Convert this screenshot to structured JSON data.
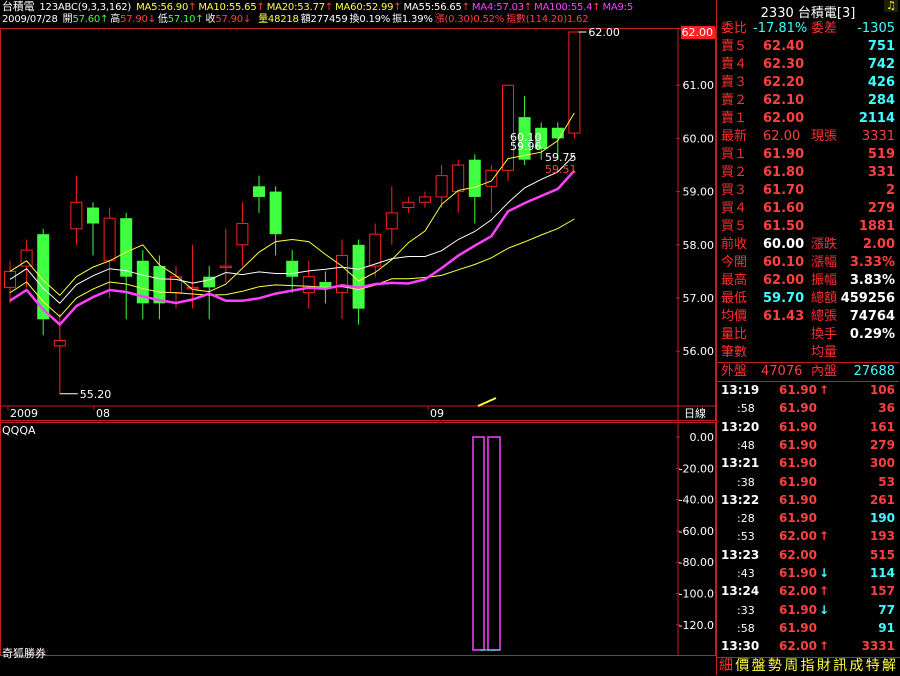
{
  "header": {
    "stock_name": "台積電",
    "indicator": "123ABC(9,3,3,162)",
    "ma_values": [
      {
        "label": "MA5:56.90",
        "color": "#ffff40",
        "arrow": "↑",
        "arrow_color": "#ff4040"
      },
      {
        "label": "MA10:55.65",
        "color": "#ffff40",
        "arrow": "↑",
        "arrow_color": "#ff4040"
      },
      {
        "label": "MA20:53.77",
        "color": "#ffff40",
        "arrow": "↑",
        "arrow_color": "#ff4040"
      },
      {
        "label": "MA60:52.99",
        "color": "#ffff40",
        "arrow": "↑",
        "arrow_color": "#ff4040"
      },
      {
        "label": "MA55:56.65",
        "color": "#ffffff",
        "arrow": "↑",
        "arrow_color": "#ff4040"
      },
      {
        "label": "MA4:57.03",
        "color": "#ff40ff",
        "arrow": "↑",
        "arrow_color": "#ff4040"
      },
      {
        "label": "MA100:55.4",
        "color": "#ff40ff",
        "arrow": "↑",
        "arrow_color": "#ff4040"
      },
      {
        "label": "MA9:5",
        "color": "#ff40ff",
        "arrow": "",
        "arrow_color": "#ff4040"
      }
    ],
    "date": "2009/07/28",
    "ohlc": [
      {
        "label": "開",
        "value": "57.60",
        "arrow": "↑",
        "color": "#40ff40"
      },
      {
        "label": "高",
        "value": "57.90",
        "arrow": "↓",
        "color": "#ff4040"
      },
      {
        "label": "低",
        "value": "57.10",
        "arrow": "↑",
        "color": "#40ff40"
      },
      {
        "label": "收",
        "value": "57.90",
        "arrow": "↓",
        "color": "#ff4040"
      }
    ],
    "stats": [
      {
        "text": "量48218",
        "color": "#ffff40"
      },
      {
        "text": "額277459",
        "color": "#ffffff"
      },
      {
        "text": "換0.19%",
        "color": "#ffffff"
      },
      {
        "text": "振1.39%",
        "color": "#ffffff"
      },
      {
        "text": "漲(0.30)0.52%",
        "color": "#ff4040"
      },
      {
        "text": "指數(114.20)1.62",
        "color": "#ff4040"
      }
    ],
    "bell_icon": "bell-icon"
  },
  "main_chart": {
    "price_axis": [
      "62.00",
      "61.00",
      "60.00",
      "59.00",
      "58.00",
      "57.00",
      "56.00"
    ],
    "top_badge": "62.00",
    "high_label": "62.00",
    "low_label": "55.20",
    "callouts": [
      {
        "text": "60.10",
        "color": "#ffffff"
      },
      {
        "text": "59.96",
        "color": "#ffffff"
      },
      {
        "text": "59.75",
        "color": "#ffffff"
      },
      {
        "text": "59.51",
        "color": "#ff4040"
      }
    ],
    "x_labels": [
      "2009",
      "08",
      "09"
    ],
    "period_label": "日線"
  },
  "sub_chart": {
    "title": "QQQA",
    "axis": [
      "0.00",
      "-20.00",
      "-40.00",
      "-60.00",
      "-80.00",
      "-100.0",
      "-120.0"
    ]
  },
  "footer_brand": "奇狐勝券",
  "chart_data": {
    "type": "candlestick",
    "ylim": [
      55.2,
      62.0
    ],
    "x_labels": [
      "2009",
      "08",
      "09"
    ],
    "candles": [
      {
        "o": 57.2,
        "c": 57.5,
        "h": 57.7,
        "l": 56.9,
        "up": true
      },
      {
        "o": 57.6,
        "c": 57.9,
        "h": 58.1,
        "l": 57.2,
        "up": true
      },
      {
        "o": 58.2,
        "c": 56.6,
        "h": 58.3,
        "l": 56.3,
        "up": false
      },
      {
        "o": 56.1,
        "c": 56.2,
        "h": 56.7,
        "l": 55.2,
        "up": true
      },
      {
        "o": 58.3,
        "c": 58.8,
        "h": 59.3,
        "l": 58.0,
        "up": true
      },
      {
        "o": 58.7,
        "c": 58.4,
        "h": 58.8,
        "l": 57.8,
        "up": false
      },
      {
        "o": 57.7,
        "c": 58.5,
        "h": 58.7,
        "l": 57.0,
        "up": true
      },
      {
        "o": 58.5,
        "c": 57.4,
        "h": 58.6,
        "l": 56.6,
        "up": false
      },
      {
        "o": 57.7,
        "c": 56.9,
        "h": 57.9,
        "l": 56.6,
        "up": false
      },
      {
        "o": 57.6,
        "c": 56.9,
        "h": 57.8,
        "l": 56.6,
        "up": false
      },
      {
        "o": 57.1,
        "c": 57.4,
        "h": 57.6,
        "l": 56.8,
        "up": true
      },
      {
        "o": 57.2,
        "c": 57.2,
        "h": 58.0,
        "l": 56.8,
        "up": true
      },
      {
        "o": 57.4,
        "c": 57.2,
        "h": 57.6,
        "l": 56.6,
        "up": false
      },
      {
        "o": 57.6,
        "c": 57.6,
        "h": 58.3,
        "l": 57.3,
        "up": true
      },
      {
        "o": 58.0,
        "c": 58.4,
        "h": 58.8,
        "l": 57.6,
        "up": true
      },
      {
        "o": 59.1,
        "c": 58.9,
        "h": 59.3,
        "l": 58.6,
        "up": false
      },
      {
        "o": 59.0,
        "c": 58.2,
        "h": 59.1,
        "l": 57.8,
        "up": false
      },
      {
        "o": 57.7,
        "c": 57.4,
        "h": 57.9,
        "l": 57.1,
        "up": false
      },
      {
        "o": 57.1,
        "c": 57.4,
        "h": 57.7,
        "l": 56.8,
        "up": true
      },
      {
        "o": 57.3,
        "c": 57.2,
        "h": 57.5,
        "l": 56.9,
        "up": false
      },
      {
        "o": 57.1,
        "c": 57.8,
        "h": 58.1,
        "l": 56.6,
        "up": true
      },
      {
        "o": 58.0,
        "c": 56.8,
        "h": 58.1,
        "l": 56.5,
        "up": false
      },
      {
        "o": 57.6,
        "c": 58.2,
        "h": 58.4,
        "l": 57.4,
        "up": true
      },
      {
        "o": 58.3,
        "c": 58.6,
        "h": 59.1,
        "l": 58.0,
        "up": true
      },
      {
        "o": 58.7,
        "c": 58.8,
        "h": 58.9,
        "l": 58.6,
        "up": true
      },
      {
        "o": 58.8,
        "c": 58.9,
        "h": 59.0,
        "l": 58.7,
        "up": true
      },
      {
        "o": 58.9,
        "c": 59.3,
        "h": 59.5,
        "l": 58.7,
        "up": true
      },
      {
        "o": 59.0,
        "c": 59.5,
        "h": 59.6,
        "l": 58.6,
        "up": true
      },
      {
        "o": 59.6,
        "c": 58.9,
        "h": 59.7,
        "l": 58.4,
        "up": false
      },
      {
        "o": 59.1,
        "c": 59.4,
        "h": 59.5,
        "l": 58.6,
        "up": true
      },
      {
        "o": 59.4,
        "c": 61.0,
        "h": 61.0,
        "l": 59.2,
        "up": true
      },
      {
        "o": 60.4,
        "c": 59.6,
        "h": 60.8,
        "l": 59.5,
        "up": false
      },
      {
        "o": 60.2,
        "c": 59.8,
        "h": 60.3,
        "l": 59.6,
        "up": false
      },
      {
        "o": 60.2,
        "c": 60.0,
        "h": 60.3,
        "l": 59.6,
        "up": false
      },
      {
        "o": 60.1,
        "c": 62.0,
        "h": 62.0,
        "l": 60.0,
        "up": true
      }
    ],
    "series": [
      {
        "name": "MA(yellow)",
        "color": "#ffff40"
      },
      {
        "name": "MA(white)",
        "color": "#ffffff"
      },
      {
        "name": "MA(magenta)",
        "color": "#ff40ff"
      }
    ]
  },
  "right_panel": {
    "code": "2330",
    "name": "台積電",
    "suffix": "[3]",
    "ratio_label": "委比",
    "ratio_value": "-17.81%",
    "diff_label": "委差",
    "diff_value": "-1305",
    "asks": [
      {
        "label": "賣５",
        "price": "62.40",
        "vol": "751"
      },
      {
        "label": "賣４",
        "price": "62.30",
        "vol": "742"
      },
      {
        "label": "賣３",
        "price": "62.20",
        "vol": "426"
      },
      {
        "label": "賣２",
        "price": "62.10",
        "vol": "284"
      },
      {
        "label": "賣１",
        "price": "62.00",
        "vol": "2114"
      }
    ],
    "last": {
      "label": "最新",
      "price": "62.00",
      "label2": "現張",
      "vol": "3331"
    },
    "bids": [
      {
        "label": "買１",
        "price": "61.90",
        "vol": "519"
      },
      {
        "label": "買２",
        "price": "61.80",
        "vol": "331"
      },
      {
        "label": "買３",
        "price": "61.70",
        "vol": "2"
      },
      {
        "label": "買４",
        "price": "61.60",
        "vol": "279"
      },
      {
        "label": "買５",
        "price": "61.50",
        "vol": "1881"
      }
    ],
    "stats": [
      {
        "l1": "前收",
        "v1": "60.00",
        "c1": "#ffffff",
        "l2": "漲跌",
        "v2": "2.00",
        "c2": "#ff4040"
      },
      {
        "l1": "今開",
        "v1": "60.10",
        "c1": "#ff4040",
        "l2": "漲幅",
        "v2": "3.33%",
        "c2": "#ff4040"
      },
      {
        "l1": "最高",
        "v1": "62.00",
        "c1": "#ff4040",
        "l2": "振幅",
        "v2": "3.83%",
        "c2": "#ffffff"
      },
      {
        "l1": "最低",
        "v1": "59.70",
        "c1": "#40ffff",
        "l2": "總額",
        "v2": "459256",
        "c2": "#ffffff"
      },
      {
        "l1": "均價",
        "v1": "61.43",
        "c1": "#ff4040",
        "l2": "總張",
        "v2": "74764",
        "c2": "#ffffff"
      },
      {
        "l1": "量比",
        "v1": "",
        "c1": "#ffffff",
        "l2": "換手",
        "v2": "0.29%",
        "c2": "#ffffff"
      },
      {
        "l1": "筆數",
        "v1": "",
        "c1": "#ffffff",
        "l2": "均量",
        "v2": "",
        "c2": "#ffffff"
      }
    ],
    "outer_label": "外盤",
    "outer_value": "47076",
    "inner_label": "內盤",
    "inner_value": "27688",
    "ticks": [
      {
        "time": "13:19",
        "price": "61.90",
        "arrow": "↑",
        "vol": "106",
        "vcolor": "#ff4040"
      },
      {
        "time": ":58",
        "price": "61.90",
        "arrow": "",
        "vol": "36",
        "vcolor": "#ff4040"
      },
      {
        "time": "13:20",
        "price": "61.90",
        "arrow": "",
        "vol": "161",
        "vcolor": "#ff4040"
      },
      {
        "time": ":48",
        "price": "61.90",
        "arrow": "",
        "vol": "279",
        "vcolor": "#ff4040"
      },
      {
        "time": "13:21",
        "price": "61.90",
        "arrow": "",
        "vol": "300",
        "vcolor": "#ff4040"
      },
      {
        "time": ":38",
        "price": "61.90",
        "arrow": "",
        "vol": "53",
        "vcolor": "#ff4040"
      },
      {
        "time": "13:22",
        "price": "61.90",
        "arrow": "",
        "vol": "261",
        "vcolor": "#ff4040"
      },
      {
        "time": ":28",
        "price": "61.90",
        "arrow": "",
        "vol": "190",
        "vcolor": "#40ffff"
      },
      {
        "time": ":53",
        "price": "62.00",
        "arrow": "↑",
        "vol": "193",
        "vcolor": "#ff4040"
      },
      {
        "time": "13:23",
        "price": "62.00",
        "arrow": "",
        "vol": "515",
        "vcolor": "#ff4040"
      },
      {
        "time": ":43",
        "price": "61.90",
        "arrow": "↓",
        "vol": "114",
        "vcolor": "#40ffff"
      },
      {
        "time": "13:24",
        "price": "62.00",
        "arrow": "↑",
        "vol": "157",
        "vcolor": "#ff4040"
      },
      {
        "time": ":33",
        "price": "61.90",
        "arrow": "↓",
        "vol": "77",
        "vcolor": "#40ffff"
      },
      {
        "time": ":58",
        "price": "61.90",
        "arrow": "",
        "vol": "91",
        "vcolor": "#40ffff"
      },
      {
        "time": "13:30",
        "price": "62.00",
        "arrow": "↑",
        "vol": "3331",
        "vcolor": "#ff4040"
      }
    ],
    "bottom_tabs": [
      "細",
      "價",
      "盤",
      "勢",
      "周",
      "指",
      "財",
      "訊",
      "成",
      "特",
      "解"
    ]
  }
}
